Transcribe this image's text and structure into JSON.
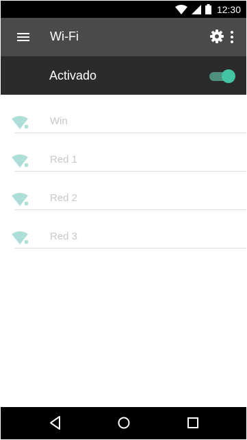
{
  "status_bar": {
    "time": "12:30",
    "icons": [
      "wifi-signal-icon",
      "cell-signal-icon",
      "battery-icon"
    ]
  },
  "app_bar": {
    "title": "Wi-Fi",
    "menu_icon": "menu-icon",
    "settings_icon": "gear-icon",
    "more_icon": "more-vert-icon"
  },
  "toggle": {
    "label": "Activado",
    "state": "on",
    "accent_color": "#43c4a3"
  },
  "networks": [
    {
      "name": "Win",
      "icon": "wifi-lock-icon"
    },
    {
      "name": "Red 1",
      "icon": "wifi-lock-icon"
    },
    {
      "name": "Red 2",
      "icon": "wifi-lock-icon"
    },
    {
      "name": "Red 3",
      "icon": "wifi-lock-icon"
    }
  ],
  "nav_bar": {
    "buttons": [
      "back-icon",
      "home-icon",
      "recents-icon"
    ]
  }
}
